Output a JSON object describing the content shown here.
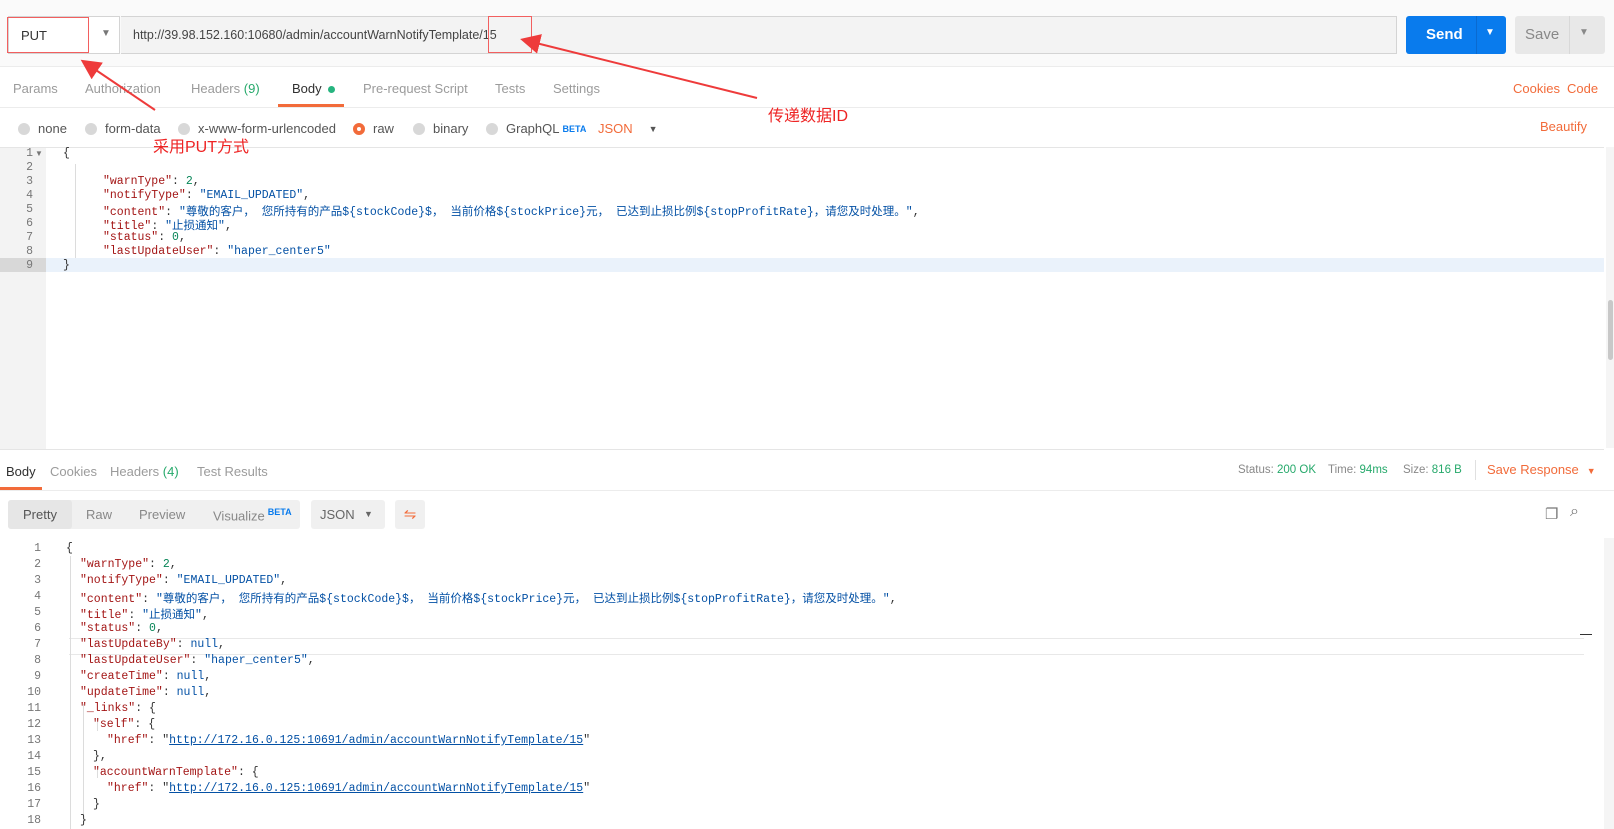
{
  "request": {
    "method": "PUT",
    "url": "http://39.98.152.160:10680/admin/accountWarnNotifyTemplate/15",
    "send_label": "Send",
    "save_label": "Save"
  },
  "annotations": {
    "put_label": "采用PUT方式",
    "id_label": "传递数据ID"
  },
  "request_tabs": {
    "params": "Params",
    "authorization": "Authorization",
    "headers": "Headers",
    "headers_count": "(9)",
    "body": "Body",
    "pre_request": "Pre-request Script",
    "tests": "Tests",
    "settings": "Settings",
    "cookies": "Cookies",
    "code": "Code"
  },
  "body_options": {
    "none": "none",
    "form_data": "form-data",
    "urlencoded": "x-www-form-urlencoded",
    "raw": "raw",
    "binary": "binary",
    "graphql": "GraphQL",
    "beta": "BETA",
    "format": "JSON",
    "beautify": "Beautify",
    "selected": "raw"
  },
  "request_body": {
    "line_numbers": [
      "1",
      "2",
      "3",
      "4",
      "5",
      "6",
      "7",
      "8",
      "9"
    ],
    "line1": "{",
    "warnType_key": "\"warnType\"",
    "warnType_val": "2",
    "notifyType_key": "\"notifyType\"",
    "notifyType_val": "\"EMAIL_UPDATED\"",
    "content_key": "\"content\"",
    "content_val": "\"尊敬的客户， 您所持有的产品${stockCode}$， 当前价格${stockPrice}元， 已达到止损比例${stopProfitRate}，请您及时处理。\"",
    "title_key": "\"title\"",
    "title_val": "\"止损通知\"",
    "status_key": "\"status\"",
    "status_val": "0",
    "lastUpdateUser_key": "\"lastUpdateUser\"",
    "lastUpdateUser_val": "\"haper_center5\"",
    "line9": "}"
  },
  "response_tabs": {
    "body": "Body",
    "cookies": "Cookies",
    "headers": "Headers",
    "headers_count": "(4)",
    "test_results": "Test Results"
  },
  "response_meta": {
    "status_label": "Status:",
    "status_value": "200 OK",
    "time_label": "Time:",
    "time_value": "94ms",
    "size_label": "Size:",
    "size_value": "816 B",
    "save_response": "Save Response"
  },
  "response_view": {
    "pretty": "Pretty",
    "raw": "Raw",
    "preview": "Preview",
    "visualize": "Visualize",
    "beta": "BETA",
    "format": "JSON"
  },
  "response_body": {
    "line_numbers": [
      "1",
      "2",
      "3",
      "4",
      "5",
      "6",
      "7",
      "8",
      "9",
      "10",
      "11",
      "12",
      "13",
      "14",
      "15",
      "16",
      "17",
      "18"
    ],
    "open": "{",
    "warnType_key": "\"warnType\"",
    "warnType_val": "2",
    "notifyType_key": "\"notifyType\"",
    "notifyType_val": "\"EMAIL_UPDATED\"",
    "content_key": "\"content\"",
    "content_val": "\"尊敬的客户， 您所持有的产品${stockCode}$， 当前价格${stockPrice}元， 已达到止损比例${stopProfitRate}，请您及时处理。\"",
    "title_key": "\"title\"",
    "title_val": "\"止损通知\"",
    "status_key": "\"status\"",
    "status_val": "0",
    "lastUpdateBy_key": "\"lastUpdateBy\"",
    "null_val": "null",
    "lastUpdateUser_key": "\"lastUpdateUser\"",
    "lastUpdateUser_val": "\"haper_center5\"",
    "createTime_key": "\"createTime\"",
    "updateTime_key": "\"updateTime\"",
    "links_key": "\"_links\"",
    "self_key": "\"self\"",
    "href_key": "\"href\"",
    "href_val": "http://172.16.0.125:10691/admin/accountWarnNotifyTemplate/15",
    "accountWarnTemplate_key": "\"accountWarnTemplate\"",
    "close_inner": "}",
    "close_inner_comma": "},",
    "close": "}"
  },
  "colors": {
    "accent_orange": "#f26b3a",
    "send_blue": "#097bed",
    "status_green": "#26a96b",
    "annotation_red": "#ee2424"
  }
}
